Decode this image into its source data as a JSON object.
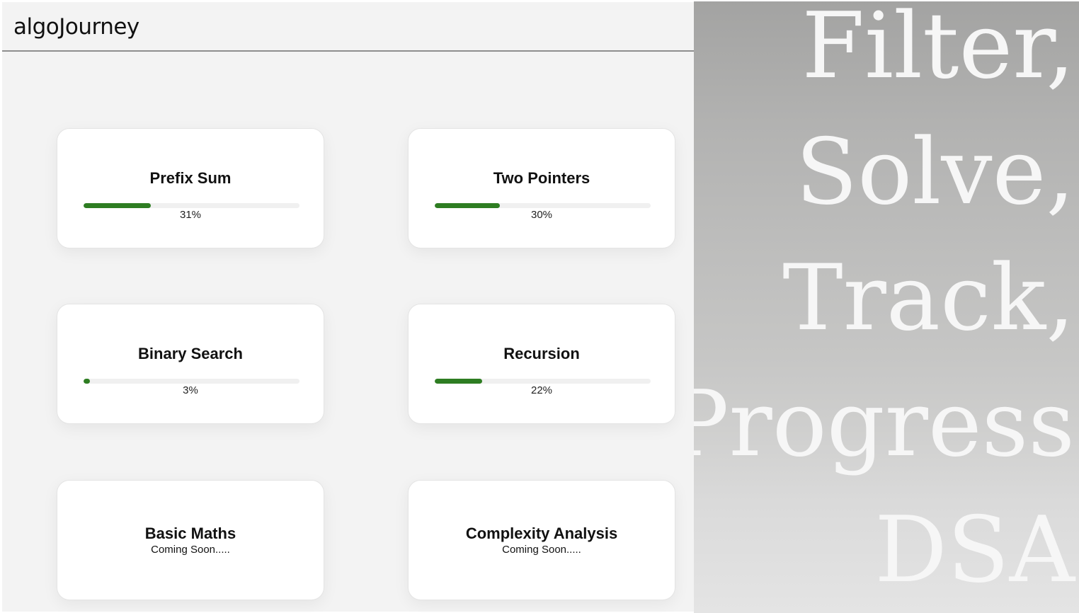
{
  "header": {
    "brand": "algoJourney"
  },
  "topics": [
    {
      "title": "Prefix Sum",
      "progress": 31,
      "progress_label": "31%"
    },
    {
      "title": "Two Pointers",
      "progress": 30,
      "progress_label": "30%"
    },
    {
      "title": "Binary Search",
      "progress": 3,
      "progress_label": "3%"
    },
    {
      "title": "Recursion",
      "progress": 22,
      "progress_label": "22%"
    },
    {
      "title": "Basic Maths",
      "status": "Coming Soon....."
    },
    {
      "title": "Complexity Analysis",
      "status": "Coming Soon....."
    }
  ],
  "hero": {
    "lines": [
      "Filter,",
      "Solve,",
      "Track,",
      "Progress",
      "DSA"
    ]
  },
  "colors": {
    "progress_fill": "#2e7d22",
    "progress_track": "#f0f0f0",
    "hero_text": "#f6f6f6"
  }
}
